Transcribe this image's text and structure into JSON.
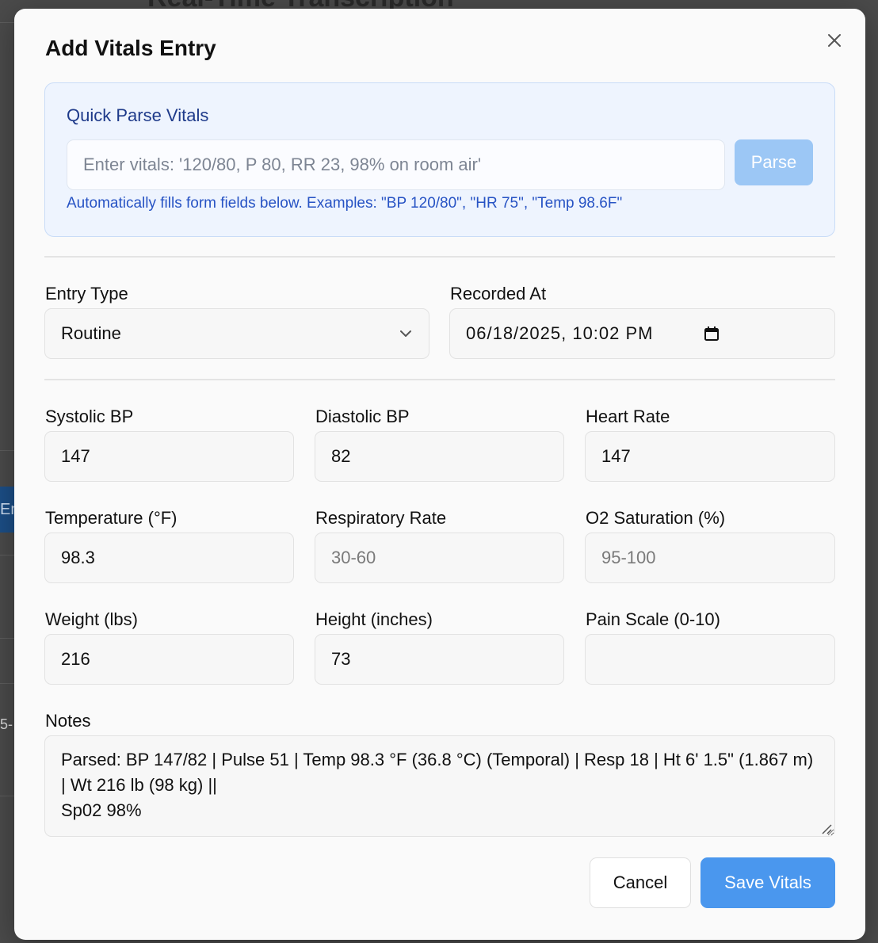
{
  "background": {
    "page_title": "Real-Time Transcription",
    "side_tab_text": "En",
    "side_number_text": "5-"
  },
  "modal": {
    "title": "Add Vitals Entry",
    "close_icon": "close-icon"
  },
  "quick_parse": {
    "title": "Quick Parse Vitals",
    "input_value": "",
    "input_placeholder": "Enter vitals: '120/80, P 80, RR 23, 98% on room air'",
    "button_label": "Parse",
    "help_text": "Automatically fills form fields below. Examples: \"BP 120/80\", \"HR 75\", \"Temp 98.6F\""
  },
  "entry_type": {
    "label": "Entry Type",
    "selected": "Routine",
    "icon": "chevron-down-icon"
  },
  "recorded_at": {
    "label": "Recorded At",
    "value": "06/18/2025, 10:02 PM",
    "icon": "calendar-icon"
  },
  "vitals": {
    "systolic_bp": {
      "label": "Systolic BP",
      "value": "147",
      "placeholder": ""
    },
    "diastolic_bp": {
      "label": "Diastolic BP",
      "value": "82",
      "placeholder": ""
    },
    "heart_rate": {
      "label": "Heart Rate",
      "value": "147",
      "placeholder": ""
    },
    "temperature": {
      "label": "Temperature (°F)",
      "value": "98.3",
      "placeholder": ""
    },
    "respiratory_rate": {
      "label": "Respiratory Rate",
      "value": "",
      "placeholder": "30-60"
    },
    "o2_saturation": {
      "label": "O2 Saturation (%)",
      "value": "",
      "placeholder": "95-100"
    },
    "weight": {
      "label": "Weight (lbs)",
      "value": "216",
      "placeholder": ""
    },
    "height": {
      "label": "Height (inches)",
      "value": "73",
      "placeholder": ""
    },
    "pain_scale": {
      "label": "Pain Scale (0-10)",
      "value": "",
      "placeholder": ""
    }
  },
  "notes": {
    "label": "Notes",
    "value": "Parsed: BP 147/82 | Pulse 51 | Temp 98.3 °F (36.8 °C) (Temporal) | Resp 18 | Ht 6' 1.5\" (1.867 m) | Wt 216 lb (98 kg) ||\nSp02 98%"
  },
  "actions": {
    "cancel_label": "Cancel",
    "save_label": "Save Vitals"
  },
  "colors": {
    "primary": "#4a97ee",
    "primary_disabled": "#9cc7f5",
    "info_bg": "#eef4fe",
    "info_title": "#1e3a8a",
    "info_text": "#2753c4"
  }
}
